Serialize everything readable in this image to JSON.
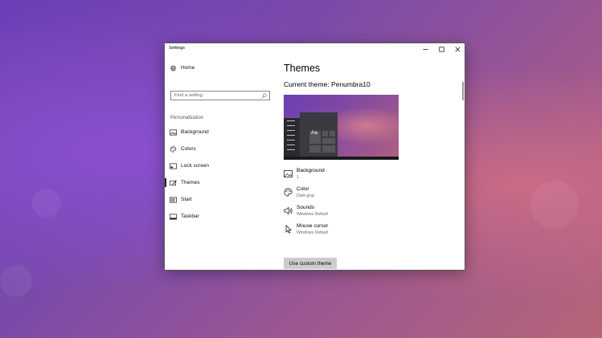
{
  "window": {
    "title": "Settings"
  },
  "sidebar": {
    "home_label": "Home",
    "search_placeholder": "Find a setting",
    "section_label": "Personalization",
    "items": [
      {
        "label": "Background",
        "icon": "picture-icon"
      },
      {
        "label": "Colors",
        "icon": "palette-icon"
      },
      {
        "label": "Lock screen",
        "icon": "lock-screen-icon"
      },
      {
        "label": "Themes",
        "icon": "brush-icon",
        "selected": true
      },
      {
        "label": "Start",
        "icon": "start-icon"
      },
      {
        "label": "Taskbar",
        "icon": "taskbar-icon"
      }
    ]
  },
  "main": {
    "heading": "Themes",
    "current_theme": "Current theme: Penumbra10",
    "preview_text": "Aa",
    "properties": [
      {
        "title": "Background",
        "value": "1",
        "icon": "picture-icon"
      },
      {
        "title": "Color",
        "value": "Dark gray",
        "icon": "palette-icon"
      },
      {
        "title": "Sounds",
        "value": "Windows Default",
        "icon": "speaker-icon"
      },
      {
        "title": "Mouse cursor",
        "value": "Windows Default",
        "icon": "cursor-icon"
      }
    ],
    "custom_theme_button": "Use custom theme"
  },
  "colors": {
    "accent": "#222222",
    "button_bg": "#cccccc",
    "wallpaper_purple": "#7a4aaa",
    "wallpaper_pink": "#c96b86"
  }
}
